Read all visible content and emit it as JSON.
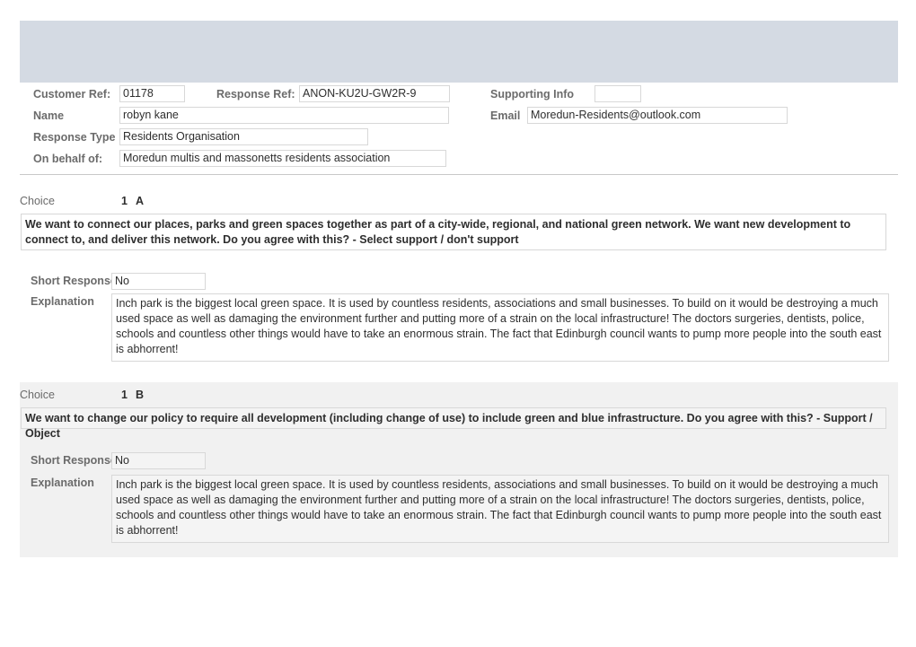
{
  "banner": {
    "color": "#d4dae3"
  },
  "header": {
    "customer_ref_label": "Customer Ref:",
    "customer_ref_value": "01178",
    "response_ref_label": "Response Ref:",
    "response_ref_value": "ANON-KU2U-GW2R-9",
    "supporting_info_label": "Supporting Info",
    "supporting_info_value": "",
    "name_label": "Name",
    "name_value": "robyn kane",
    "email_label": "Email",
    "email_value": "Moredun-Residents@outlook.com",
    "response_type_label": "Response Type",
    "response_type_value": "Residents Organisation",
    "on_behalf_of_label": "On behalf of:",
    "on_behalf_of_value": "Moredun multis and massonetts residents association"
  },
  "sections": [
    {
      "choice_label": "Choice",
      "choice_number": "1",
      "choice_letter": "A",
      "question": "We want to connect our places, parks and green spaces together as part of a city-wide, regional, and national green network. We want new development to connect to, and deliver this network. Do you agree with this? - Select support / don't support",
      "short_response_label": "Short Response",
      "short_response_value": "No",
      "explanation_label": "Explanation",
      "explanation_value": "Inch park is the biggest local green space. It is used by countless residents, associations and small businesses. To build on it would be destroying a much used space as well as damaging the environment further and putting more of a strain on the local infrastructure! The doctors surgeries, dentists, police, schools and countless other things would have to take an enormous strain. The fact that Edinburgh council wants to pump more people into the south east is abhorrent!"
    },
    {
      "choice_label": "Choice",
      "choice_number": "1",
      "choice_letter": "B",
      "question": "We want to change our policy to require all development (including change of use) to include green and blue infrastructure. Do you agree with this? - Support / Object",
      "short_response_label": "Short Response",
      "short_response_value": "No",
      "explanation_label": "Explanation",
      "explanation_value": "Inch park is the biggest local green space. It is used by countless residents, associations and small businesses. To build on it would be destroying a much used space as well as damaging the environment further and putting more of a strain on the local infrastructure! The doctors surgeries, dentists, police, schools and countless other things would have to take an enormous strain. The fact that Edinburgh council wants to pump more people into the south east is abhorrent!"
    }
  ]
}
